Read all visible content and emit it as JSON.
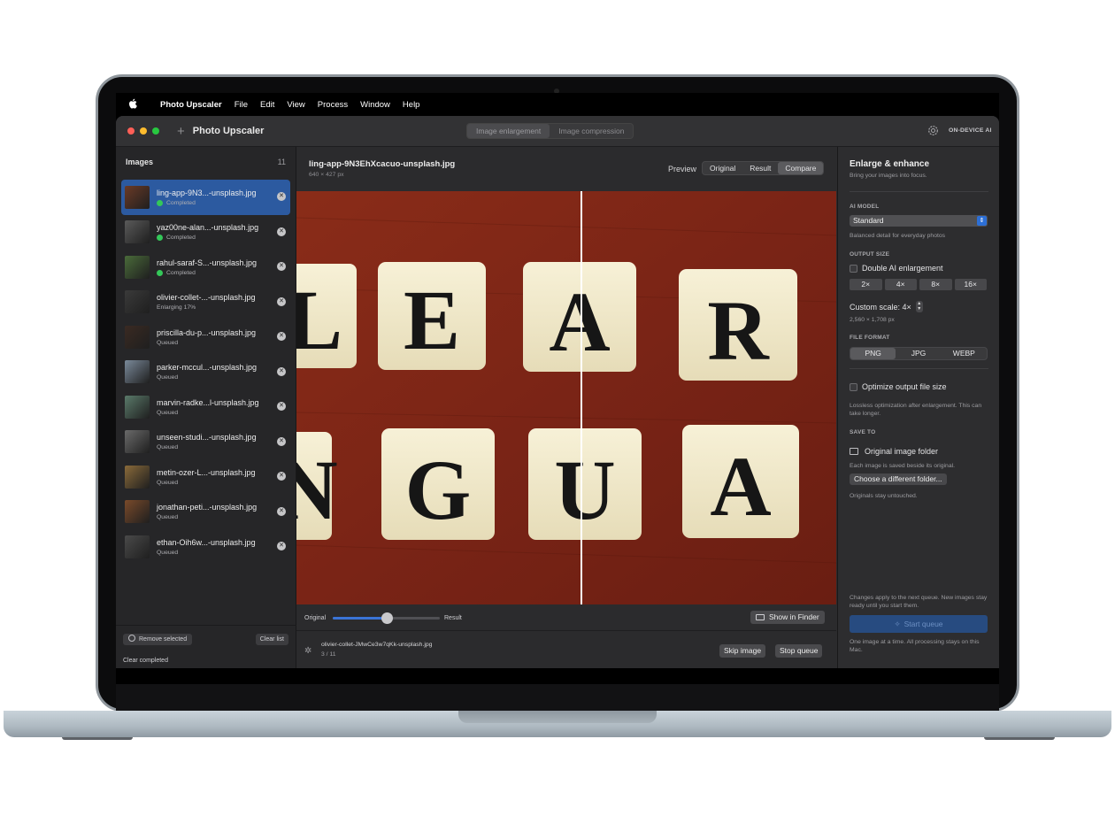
{
  "menubar": {
    "apple_icon": "apple-icon",
    "app_name": "Photo Upscaler",
    "items": [
      "File",
      "Edit",
      "View",
      "Process",
      "Window",
      "Help"
    ]
  },
  "titlebar": {
    "title": "Photo Upscaler",
    "tabs": [
      "Image enlargement",
      "Image compression"
    ],
    "selected_tab": "Image enlargement",
    "badge": "ON-DEVICE AI",
    "colors": {
      "close": "#ff5f57",
      "minimize": "#febc2e",
      "zoom": "#28c840"
    }
  },
  "sidebar": {
    "title": "Images",
    "count": "11",
    "items": [
      {
        "name": "ling-app-9N3...-unsplash.jpg",
        "status": "Completed",
        "done": true
      },
      {
        "name": "yaz00ne-alan...-unsplash.jpg",
        "status": "Completed",
        "done": true
      },
      {
        "name": "rahul-saraf-S...-unsplash.jpg",
        "status": "Completed",
        "done": true
      },
      {
        "name": "olivier-collet-...-unsplash.jpg",
        "status": "Enlarging 17%",
        "done": false
      },
      {
        "name": "priscilla-du-p...-unsplash.jpg",
        "status": "Queued",
        "done": false
      },
      {
        "name": "parker-mccul...-unsplash.jpg",
        "status": "Queued",
        "done": false
      },
      {
        "name": "marvin-radke...l-unsplash.jpg",
        "status": "Queued",
        "done": false
      },
      {
        "name": "unseen-studi...-unsplash.jpg",
        "status": "Queued",
        "done": false
      },
      {
        "name": "metin-ozer-L...-unsplash.jpg",
        "status": "Queued",
        "done": false
      },
      {
        "name": "jonathan-peti...-unsplash.jpg",
        "status": "Queued",
        "done": false
      },
      {
        "name": "ethan-Oih6w...-unsplash.jpg",
        "status": "Queued",
        "done": false
      }
    ],
    "remove_selected": "Remove selected",
    "clear_list": "Clear list",
    "clear_completed": "Clear completed"
  },
  "main": {
    "file_name": "ling-app-9N3EhXcacuo-unsplash.jpg",
    "dimensions": "640 × 427 px",
    "preview_label": "Preview",
    "modes": [
      "Original",
      "Result",
      "Compare"
    ],
    "selected_mode": "Compare",
    "tiles_top": [
      "E",
      "A",
      "R"
    ],
    "tiles_bottom": [
      "G",
      "U",
      "A"
    ],
    "slider": {
      "left_label": "Original",
      "right_label": "Result",
      "value": 0.5
    },
    "show_in_finder": "Show in Finder",
    "queue": {
      "current_file": "olivier-collet-JMwCe3w7qKk-unsplash.jpg",
      "progress": "3 / 11",
      "skip": "Skip image",
      "stop": "Stop queue"
    }
  },
  "panel": {
    "title": "Enlarge & enhance",
    "subtitle": "Bring your images into focus.",
    "ai_model_label": "AI MODEL",
    "ai_model_value": "Standard",
    "ai_model_note": "Balanced detail for everyday photos",
    "output_size_label": "OUTPUT SIZE",
    "double_label": "Double AI enlargement",
    "scales": [
      "2×",
      "4×",
      "8×",
      "16×"
    ],
    "custom_scale": "Custom scale: 4×",
    "output_dims": "2,560 × 1,708 px",
    "format_label": "FILE FORMAT",
    "formats": [
      "PNG",
      "JPG",
      "WEBP"
    ],
    "selected_format": "PNG",
    "optimize_label": "Optimize output file size",
    "optimize_note": "Lossless optimization after enlargement. This can take longer.",
    "save_to_label": "SAVE TO",
    "folder_label": "Original image folder",
    "folder_note": "Each image is saved beside its original.",
    "choose_folder": "Choose a different folder...",
    "originals_note": "Originals stay untouched.",
    "changes_note": "Changes apply to the next queue. New images stay ready until you start them.",
    "start_queue": "Start queue",
    "footer_note": "One image at a time. All processing stays on this Mac."
  }
}
